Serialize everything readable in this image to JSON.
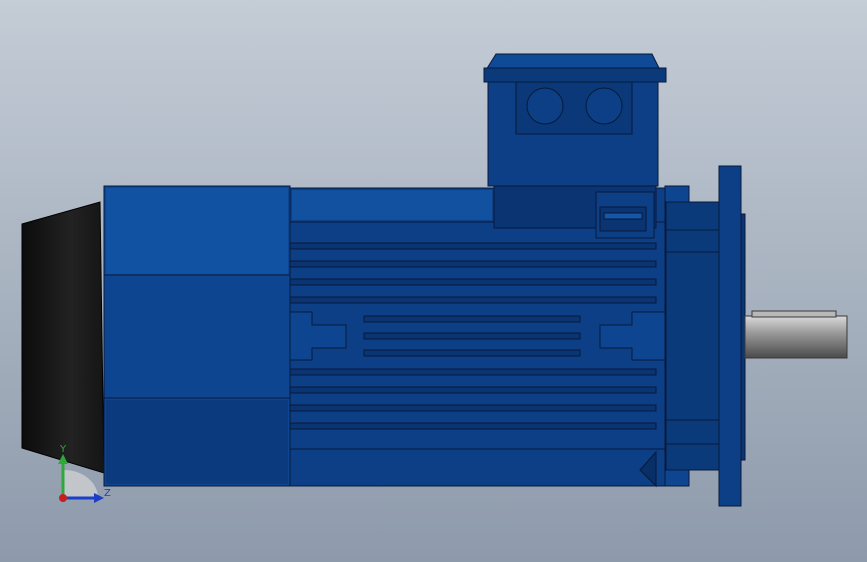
{
  "viewport": {
    "background_top": "#c4ccd6",
    "background_bottom": "#8d9aab",
    "model": {
      "body_color": "#0d3f86",
      "body_highlight": "#1656a8",
      "outline_color": "#071a3a",
      "end_cap_color": "#161616",
      "shaft_color": "#8a8a8a"
    }
  },
  "triad": {
    "y_label": "Y",
    "z_label": "Z",
    "y_color": "#2fa83b",
    "z_color": "#1d3fc7",
    "x_color": "#c41f1f"
  }
}
